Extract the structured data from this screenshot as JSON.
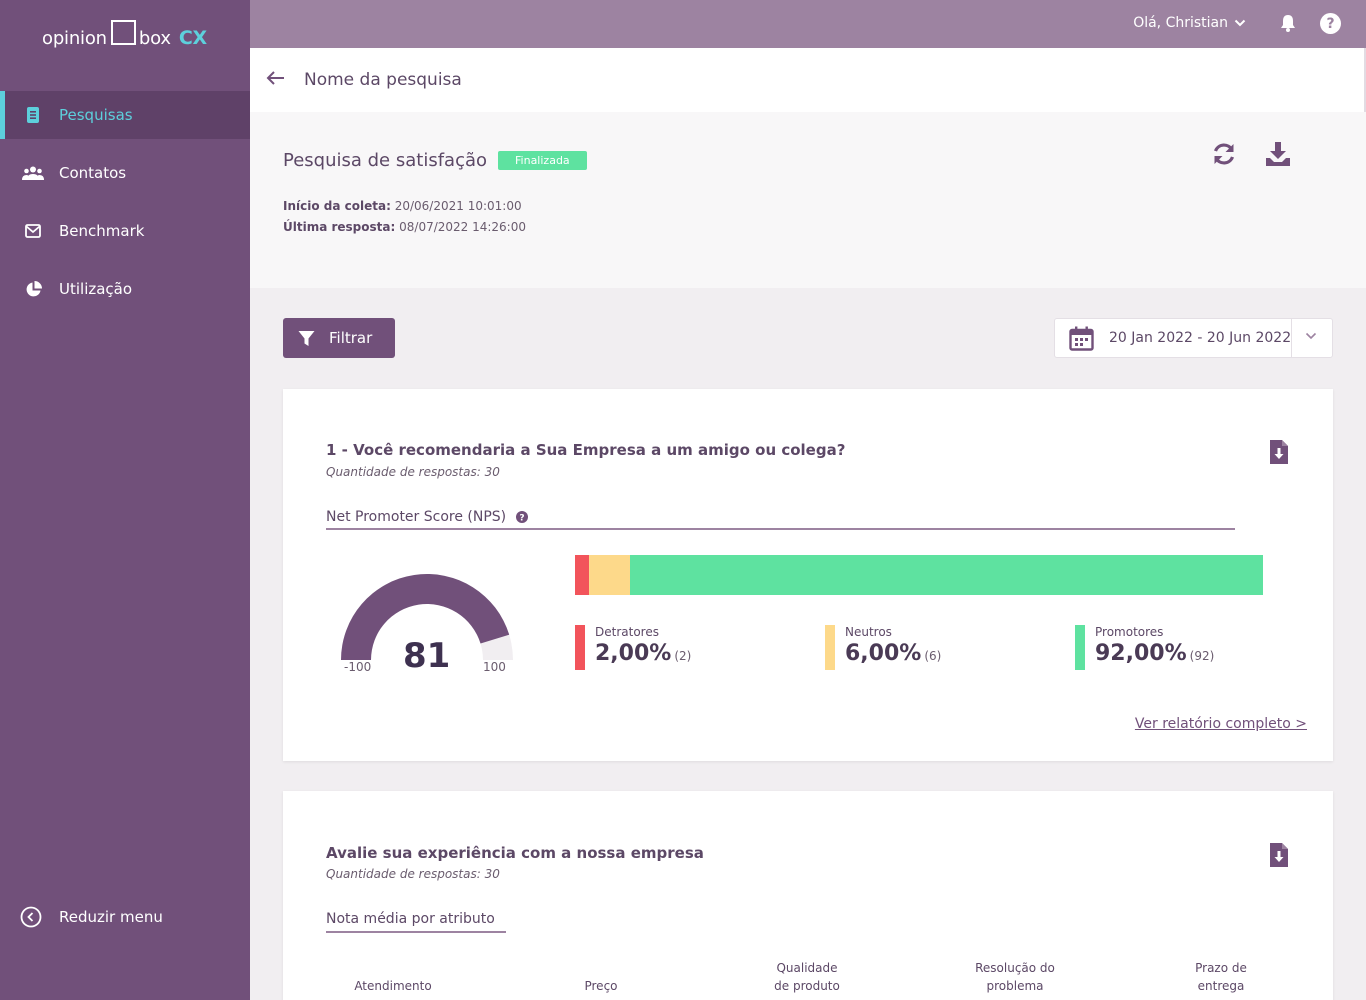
{
  "brand": {
    "logo_left": "opinion",
    "logo_right": "box",
    "logo_cx": "CX"
  },
  "sidebar": {
    "items": [
      {
        "label": "Pesquisas",
        "icon": "document-icon",
        "active": true
      },
      {
        "label": "Contatos",
        "icon": "users-icon",
        "active": false
      },
      {
        "label": "Benchmark",
        "icon": "envelope-icon",
        "active": false
      },
      {
        "label": "Utilização",
        "icon": "pie-chart-icon",
        "active": false
      }
    ],
    "collapse_label": "Reduzir menu"
  },
  "topbar": {
    "greeting": "Olá, Christian"
  },
  "breadcrumb": {
    "title": "Nome da pesquisa"
  },
  "survey": {
    "title": "Pesquisa de satisfação",
    "status": "Finalizada",
    "start_label": "Início da coleta:",
    "start_value": "20/06/2021 10:01:00",
    "last_label": "Última resposta:",
    "last_value": "08/07/2022 14:26:00"
  },
  "filters": {
    "filter_label": "Filtrar",
    "date_range": "20 Jan 2022 - 20 Jun 2022"
  },
  "question1": {
    "title": "1 - Você recomendaria a Sua Empresa a um amigo ou colega?",
    "responses": "Quantidade de respostas: 30",
    "tab": "Net Promoter Score (NPS)",
    "nps": {
      "value": "81",
      "min": "-100",
      "max": "100",
      "score": 81
    },
    "breakdown": [
      {
        "label": "Detratores",
        "percent": "2,00%",
        "count": "(2)",
        "share": 2.0,
        "color": "#f2545b"
      },
      {
        "label": "Neutros",
        "percent": "6,00%",
        "count": "(6)",
        "share": 6.0,
        "color": "#fdd98a"
      },
      {
        "label": "Promotores",
        "percent": "92,00%",
        "count": "(92)",
        "share": 92.0,
        "color": "#5ee2a0"
      }
    ],
    "report_link": "Ver relatório completo >"
  },
  "question2": {
    "title": "Avalie sua experiência com a nossa empresa",
    "responses": "Quantidade de respostas: 30",
    "tab": "Nota média por atributo",
    "attributes": [
      {
        "line1": "",
        "line2": "Atendimento"
      },
      {
        "line1": "",
        "line2": "Preço"
      },
      {
        "line1": "Qualidade",
        "line2": "de produto"
      },
      {
        "line1": "Resolução do",
        "line2": "problema"
      },
      {
        "line1": "Prazo de",
        "line2": "entrega"
      }
    ]
  },
  "colors": {
    "sidebar": "#71507a",
    "accent": "#5dd0dc",
    "topbar": "#9d83a1",
    "status": "#5ee2a0"
  }
}
